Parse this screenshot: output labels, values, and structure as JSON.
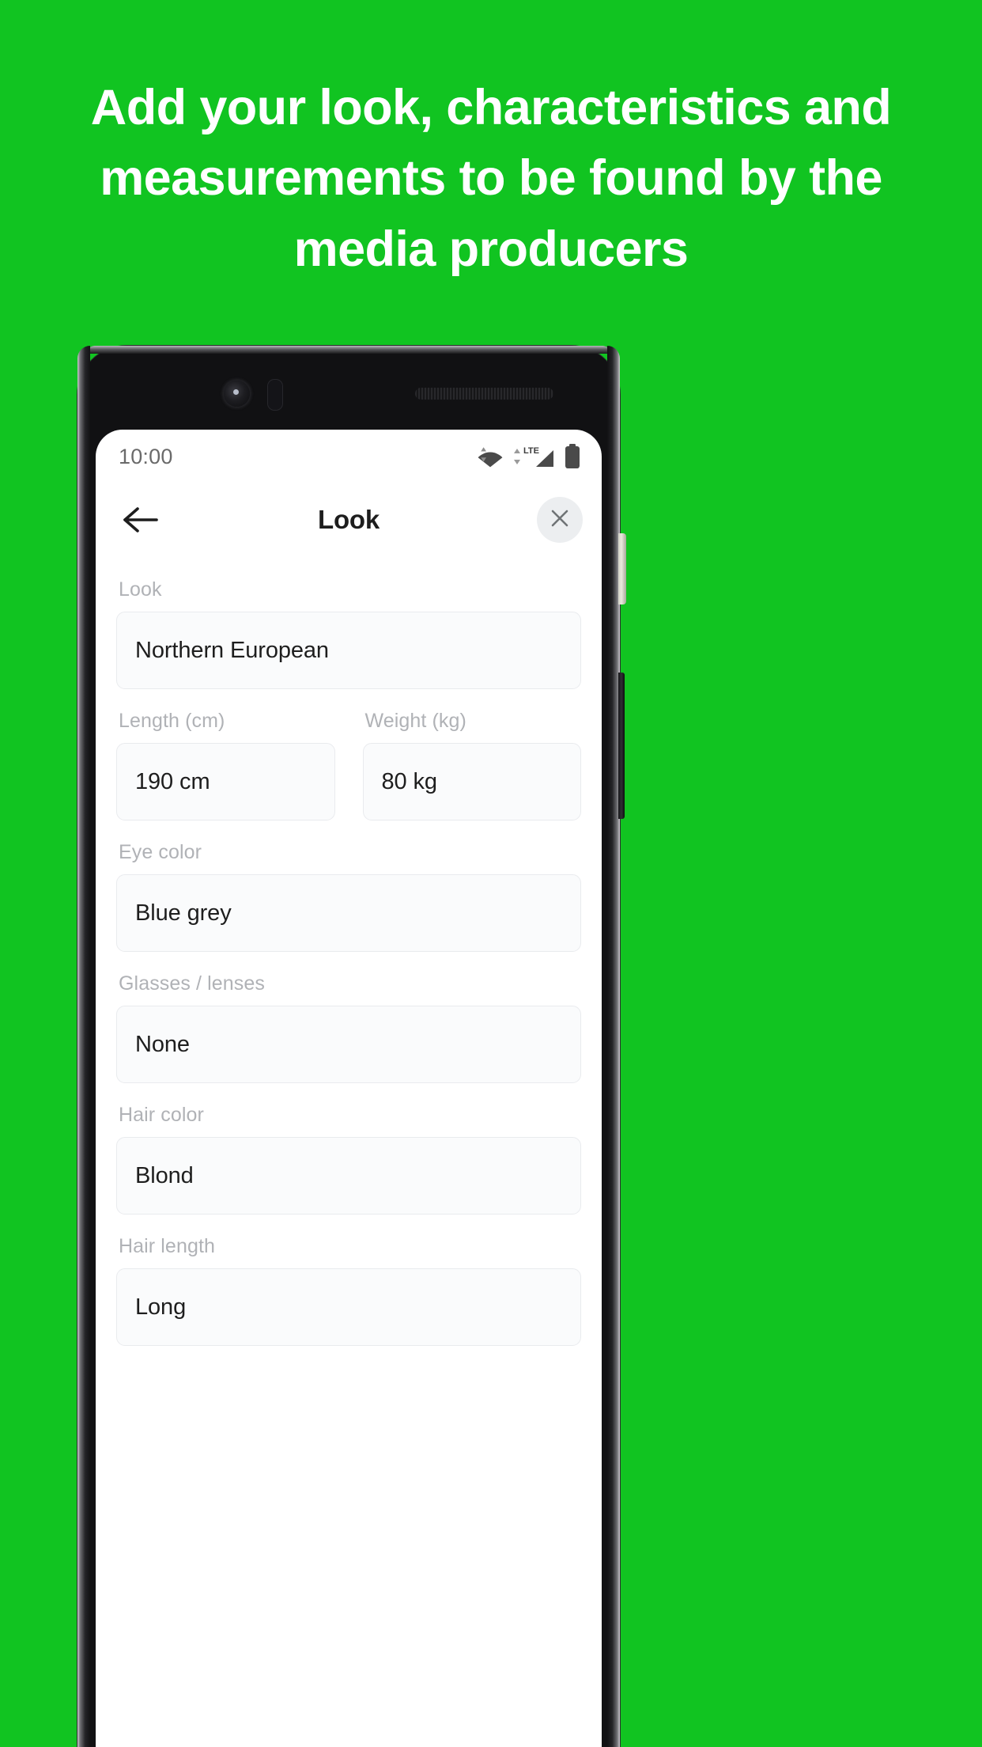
{
  "promo": {
    "headline": "Add your look, characteristics and measurements to be found by the media producers",
    "background_color": "#11c421",
    "headline_color": "#ffffff"
  },
  "device": {
    "status_bar": {
      "time": "10:00",
      "icons": [
        "wifi-icon",
        "lte-signal-icon",
        "battery-icon"
      ],
      "network_label": "LTE"
    }
  },
  "app": {
    "header": {
      "back_label": "Back",
      "title": "Look",
      "close_label": "Close"
    },
    "form": {
      "fields": [
        {
          "label": "Look",
          "value": "Northern European"
        },
        {
          "label": "Length (cm)",
          "value": "190 cm"
        },
        {
          "label": "Weight (kg)",
          "value": "80 kg"
        },
        {
          "label": "Eye color",
          "value": "Blue grey"
        },
        {
          "label": "Glasses / lenses",
          "value": "None"
        },
        {
          "label": "Hair color",
          "value": "Blond"
        },
        {
          "label": "Hair length",
          "value": "Long"
        }
      ]
    }
  }
}
